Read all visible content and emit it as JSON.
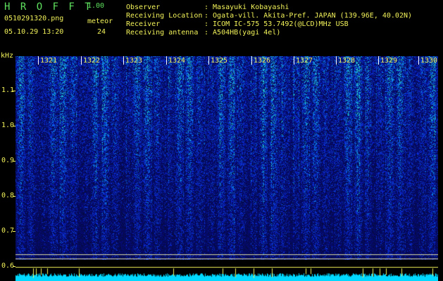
{
  "header": {
    "app_title": "H R O F F T",
    "version": "1.00",
    "filename": "0510291320.png",
    "meteor_label": "meteor",
    "datetime": "05.10.29 13:20",
    "meteor_count": "24",
    "info_labels": [
      "Observer",
      "Receiving Location",
      "Receiver",
      "Receiving antenna"
    ],
    "info_values": [
      ": Masayuki Kobayashi",
      ": Ogata-vill. Akita-Pref. JAPAN (139.96E, 40.02N)",
      ": ICOM IC-575 53.7492(@LCD)MHz USB",
      ": A504HB(yagi 4el)"
    ]
  },
  "plot": {
    "y_unit": "kHz",
    "y_ticks": [
      "1.1",
      "1.0",
      "0.9",
      "0.8",
      "0.7",
      "0.6"
    ],
    "x_ticks": [
      "1321",
      "1322",
      "1323",
      "1324",
      "1325",
      "1326",
      "1327",
      "1328",
      "1329",
      "1330"
    ],
    "colors": {
      "text": "#f2f25a",
      "header_green": "#5ee05e",
      "background": "#000000",
      "noise_base": "#0a1a8c"
    }
  }
}
